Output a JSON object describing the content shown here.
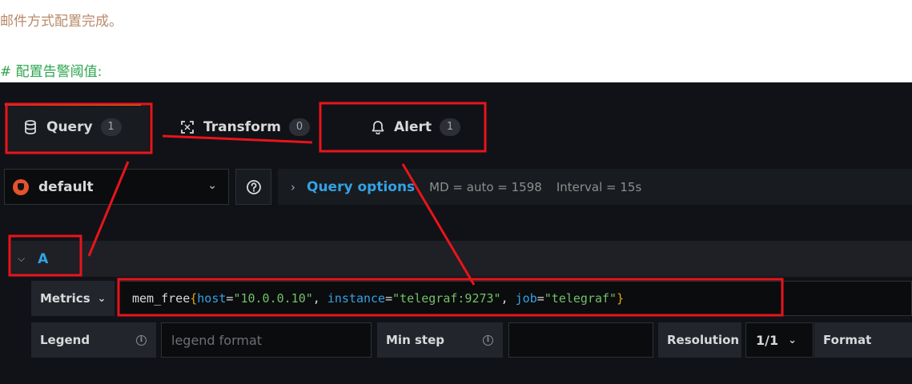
{
  "doc": {
    "line1": "邮件方式配置完成。",
    "line2": "# 配置告警阈值:"
  },
  "tabs": [
    {
      "label": "Query",
      "count": "1",
      "icon": "database-icon"
    },
    {
      "label": "Transform",
      "count": "0",
      "icon": "transform-icon"
    },
    {
      "label": "Alert",
      "count": "1",
      "icon": "bell-icon"
    }
  ],
  "datasource": {
    "name": "default",
    "icon": "prometheus-logo"
  },
  "query_options": {
    "title": "Query options",
    "md": "MD = auto = 1598",
    "interval": "Interval = 15s"
  },
  "query": {
    "refid": "A",
    "metrics_label": "Metrics",
    "expr": {
      "metric": "mem_free",
      "open": "{",
      "close": "}",
      "labels": [
        {
          "key": "host",
          "op": "=",
          "value": "\"10.0.0.10\"",
          "sep": ", "
        },
        {
          "key": "instance",
          "op": "=",
          "value": "\"telegraf:9273\"",
          "sep": ", "
        },
        {
          "key": "job",
          "op": "=",
          "value": "\"telegraf\"",
          "sep": ""
        }
      ]
    },
    "legend_label": "Legend",
    "legend_placeholder": "legend format",
    "min_step_label": "Min step",
    "resolution_label": "Resolution",
    "resolution_value": "1/1",
    "format_label": "Format"
  },
  "colors": {
    "annotation": "#e8141b",
    "link": "#33a2e5",
    "string": "#73bf69",
    "brace": "#e6a90f"
  }
}
